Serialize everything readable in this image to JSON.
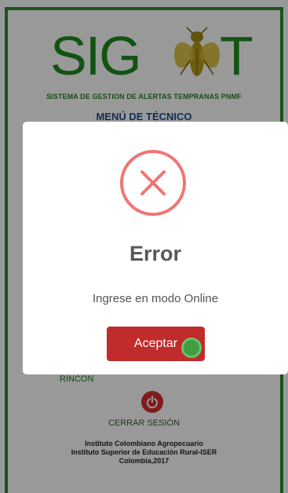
{
  "app": {
    "logo_left": "SIG",
    "logo_right": "T",
    "tagline": "SISTEMA DE GESTION DE ALERTAS TEMPRANAS PNMF",
    "menu_title": "MENÚ DE TÉCNICO",
    "partial_item": "RINCON",
    "logout_label": "CERRAR SESIÓN",
    "footer": {
      "line1": "Instituto Colombiano Agropecuario",
      "line2": "Instituto Superior de Educación Rural-ISER",
      "line3": "Colombia,2017"
    }
  },
  "dialog": {
    "icon": "error-x-icon",
    "title": "Error",
    "message": "Ingrese en modo Online",
    "confirm_label": "Aceptar"
  },
  "colors": {
    "frame": "#2e8b2e",
    "logo": "#1f8a1f",
    "error": "#f27474",
    "confirm": "#c12b2b"
  }
}
